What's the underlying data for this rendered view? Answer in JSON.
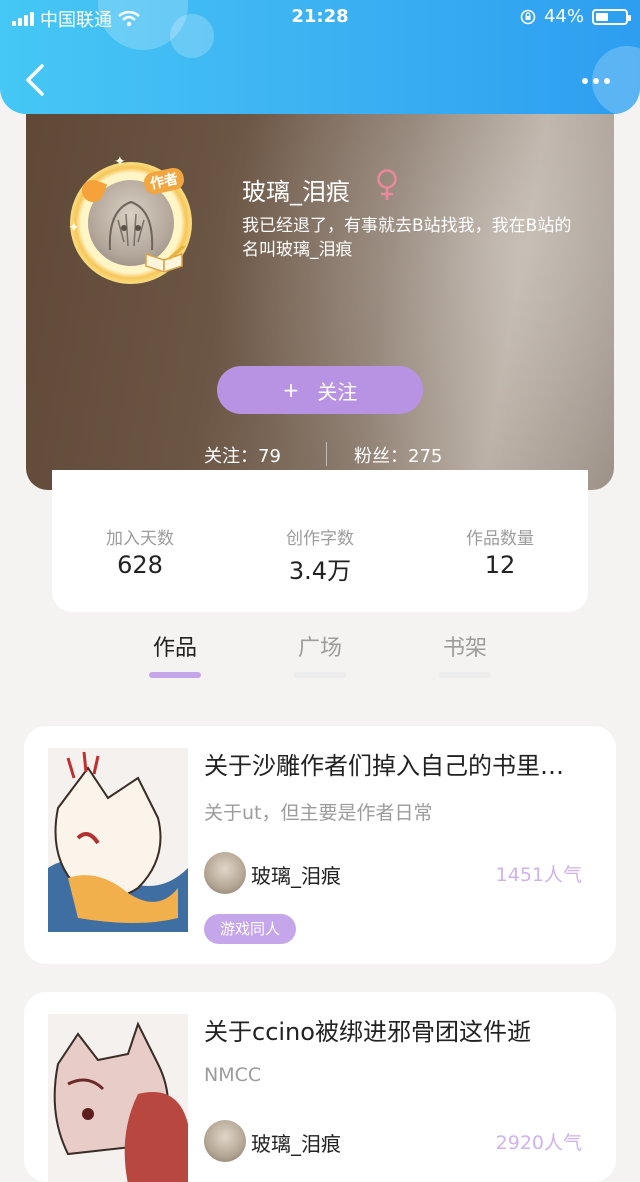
{
  "status_bar": {
    "carrier": "中国联通",
    "time": "21:28",
    "battery": "44%",
    "battery_level": 0.44
  },
  "profile": {
    "name": "玻璃_泪痕",
    "author_badge": "作者",
    "bio": "我已经退了，有事就去B站找我，我在B站的名叫玻璃_泪痕",
    "follow_button": "关注",
    "following_label": "关注：79",
    "fans_label": "粉丝：275"
  },
  "stats": [
    {
      "label": "加入天数",
      "value": "628"
    },
    {
      "label": "创作字数",
      "value": "3.4万"
    },
    {
      "label": "作品数量",
      "value": "12"
    }
  ],
  "tabs": [
    {
      "label": "作品",
      "active": true
    },
    {
      "label": "广场",
      "active": false
    },
    {
      "label": "书架",
      "active": false
    }
  ],
  "works": [
    {
      "title": "关于沙雕作者们掉入自己的书里…",
      "subtitle": "关于ut，但主要是作者日常",
      "author": "玻璃_泪痕",
      "popularity": "1451人气",
      "tag": "游戏同人"
    },
    {
      "title": "关于ccino被绑进邪骨团这件逝",
      "subtitle": "NMCC",
      "author": "玻璃_泪痕",
      "popularity": "2920人气",
      "tag": ""
    }
  ],
  "colors": {
    "header_blue": "#3fb6f3",
    "accent_purple": "#c6a6ea",
    "female_pink": "#e8889a"
  }
}
